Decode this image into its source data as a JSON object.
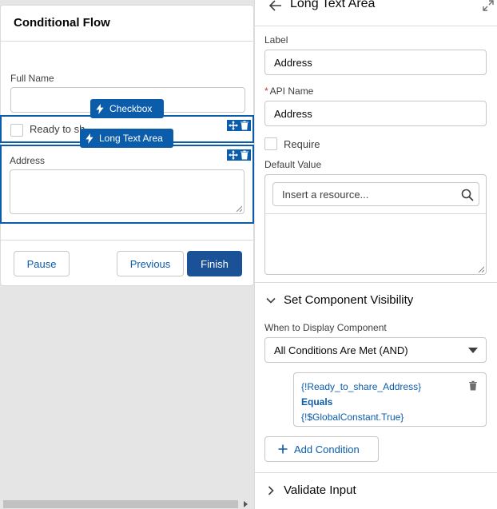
{
  "canvas": {
    "screen_title": "Conditional Flow",
    "fields": {
      "full_name_label": "Full Name",
      "checkbox_label": "Ready to sh",
      "address_label": "Address"
    },
    "tags": {
      "checkbox": "Checkbox",
      "long_text_area": "Long Text Area"
    },
    "buttons": {
      "pause": "Pause",
      "previous": "Previous",
      "finish": "Finish"
    }
  },
  "panel": {
    "title": "Long Text Area",
    "label_label": "Label",
    "label_value": "Address",
    "api_name_label": "API Name",
    "api_name_value": "Address",
    "required_marker": "*",
    "require_label": "Require",
    "default_value_label": "Default Value",
    "resource_placeholder": "Insert a resource...",
    "visibility": {
      "section_title": "Set Component Visibility",
      "when_label": "When to Display Component",
      "when_value": "All Conditions Are Met (AND)",
      "condition": {
        "resource": "{!Ready_to_share_Address}",
        "operator": "Equals",
        "value": "{!$GlobalConstant.True}"
      },
      "add_condition_label": "Add Condition"
    },
    "validate_section_title": "Validate Input"
  },
  "colors": {
    "brand_blue": "#0b5cab",
    "finish_button": "#1b5297",
    "required_red": "#c23934"
  }
}
